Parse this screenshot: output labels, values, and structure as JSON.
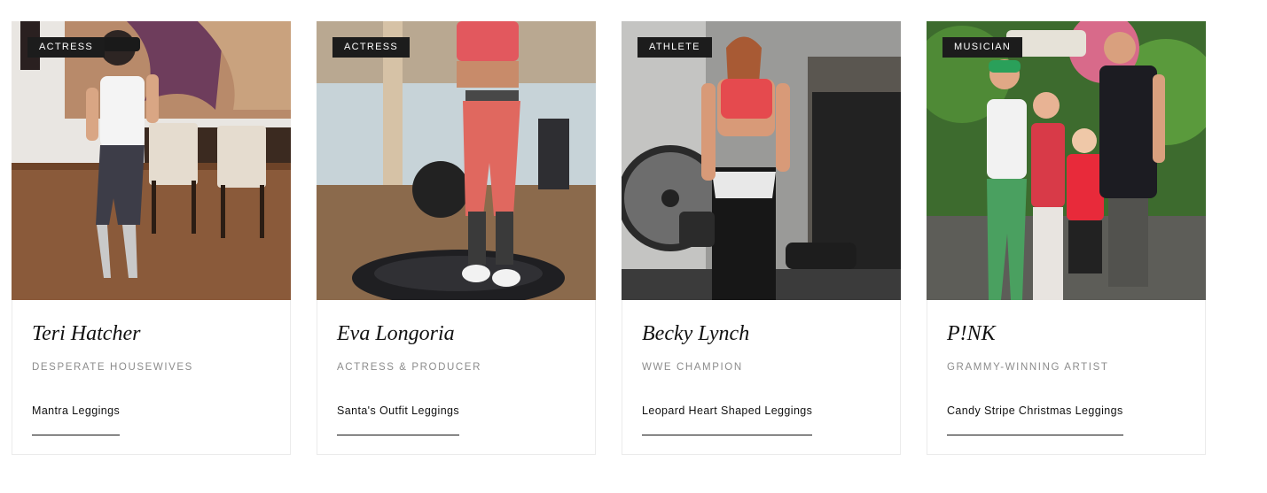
{
  "cards": [
    {
      "badge": "ACTRESS",
      "name": "Teri Hatcher",
      "subtitle": "DESPERATE HOUSEWIVES",
      "product": "Mantra Leggings"
    },
    {
      "badge": "ACTRESS",
      "name": "Eva Longoria",
      "subtitle": "ACTRESS & PRODUCER",
      "product": "Santa's Outfit Leggings"
    },
    {
      "badge": "ATHLETE",
      "name": "Becky Lynch",
      "subtitle": "WWE CHAMPION",
      "product": "Leopard Heart Shaped Leggings"
    },
    {
      "badge": "MUSICIAN",
      "name": "P!NK",
      "subtitle": "GRAMMY-WINNING ARTIST",
      "product": "Candy Stripe Christmas Leggings"
    }
  ]
}
